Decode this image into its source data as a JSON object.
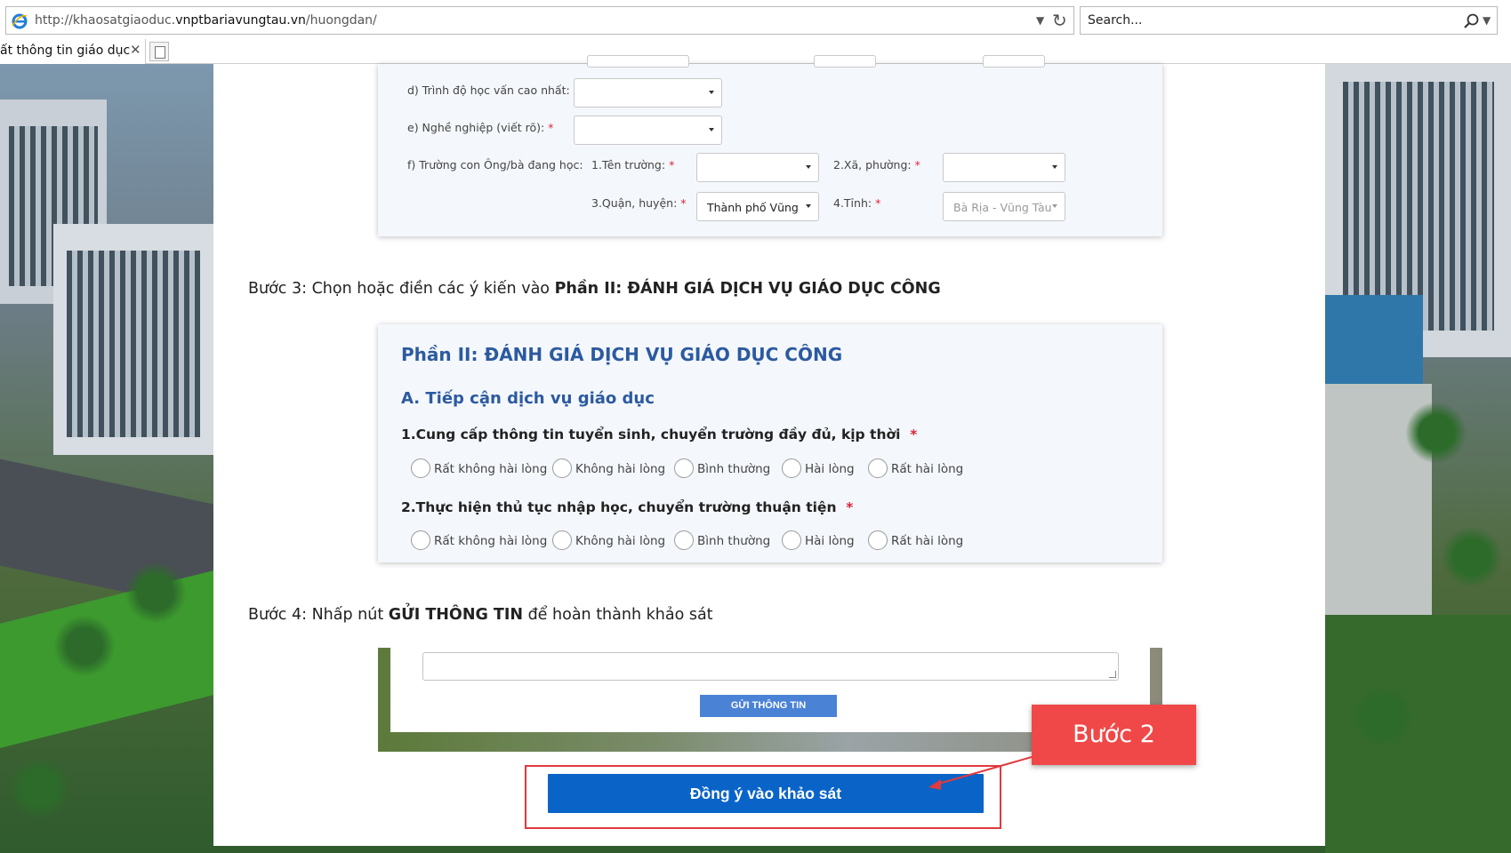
{
  "browser": {
    "url_prefix": "http://khaosatgiaoduc.",
    "url_domain": "vnptbariavungtau.vn",
    "url_path": "/huongdan/",
    "search_placeholder": "Search...",
    "tab_title": "ất thông tin giáo dục"
  },
  "form_section": {
    "education_label": "d) Trình độ học vấn cao nhất:",
    "occupation_label": "e) Nghề nghiệp (viết rõ):",
    "school_label": "f) Trường con Ông/bà đang học:",
    "school_name_label": "1.Tên trường:",
    "ward_label": "2.Xã, phường:",
    "district_label": "3.Quận, huyện:",
    "province_label": "4.Tỉnh:",
    "district_value": "Thành phố Vũng T",
    "province_value": "Bà Rịa - Vũng Tàu",
    "required_mark": "*"
  },
  "step3": {
    "prefix": "Bước 3: Chọn hoặc điền các ý kiến vào ",
    "bold": "Phần II: ĐÁNH GIÁ DỊCH VỤ GIÁO DỤC CÔNG"
  },
  "survey": {
    "title": "Phần II: ĐÁNH GIÁ DỊCH VỤ GIÁO DỤC CÔNG",
    "subtitle": "A. Tiếp cận dịch vụ giáo dục",
    "q1": "1.Cung cấp thông tin tuyển sinh, chuyển trường đầy đủ, kịp thời",
    "q2": "2.Thực hiện thủ tục nhập học, chuyển trường thuận tiện",
    "options": [
      "Rất không hài lòng",
      "Không hài lòng",
      "Bình thường",
      "Hài lòng",
      "Rất hài lòng"
    ]
  },
  "step4": {
    "prefix": "Bước 4: Nhấp nút ",
    "bold": "GỬI THÔNG TIN",
    "suffix": " để hoàn thành khảo sát"
  },
  "submit_label": "GỬI THÔNG TIN",
  "agree_label": "Đồng ý vào khảo sát",
  "callout_label": "Bước 2",
  "colors": {
    "accent_blue": "#2c5aa0",
    "button_blue": "#0a64c8",
    "callout_red": "#f04848",
    "required_red": "#d9253a"
  }
}
